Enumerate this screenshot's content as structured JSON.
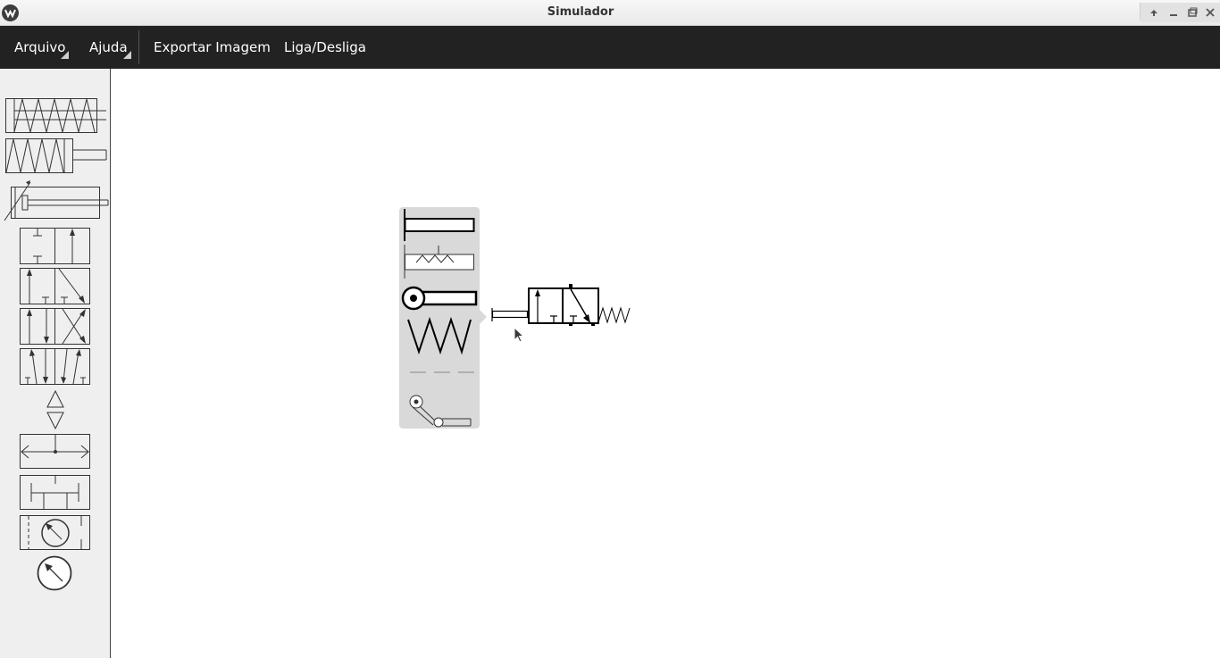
{
  "window": {
    "title": "Simulador",
    "controls": [
      "keep-above-icon",
      "minimize-icon",
      "restore-icon",
      "close-icon"
    ]
  },
  "menubar": {
    "items": [
      {
        "label": "Arquivo",
        "has_submenu": true
      },
      {
        "label": "Ajuda",
        "has_submenu": true
      },
      {
        "label": "Exportar Imagem",
        "has_submenu": false
      },
      {
        "label": "Liga/Desliga",
        "has_submenu": false
      }
    ],
    "background": "#222222",
    "text_color": "#ffffff"
  },
  "sidebar": {
    "background": "#efefef",
    "palette": [
      "double-spring-cylinder-icon",
      "spring-return-cylinder-icon",
      "adjustable-cushion-cylinder-icon",
      "valve-2-2-icon",
      "valve-3-2-icon",
      "valve-4-2-icon",
      "valve-5-2-icon",
      "pressure-source-icon",
      "exhaust-icon",
      "flow-split-icon",
      "junction-icon",
      "gauge-box-icon",
      "pressure-gauge-icon"
    ]
  },
  "popup": {
    "background": "#d9d9d9",
    "options": [
      "push-button-actuator-icon",
      "detent-actuator-icon",
      "roller-actuator-icon",
      "spring-actuator-icon",
      "pilot-line-actuator-icon",
      "roller-lever-actuator-icon"
    ]
  },
  "canvas": {
    "background": "#ffffff",
    "components": [
      "valve-3-2-with-spring-return"
    ]
  }
}
